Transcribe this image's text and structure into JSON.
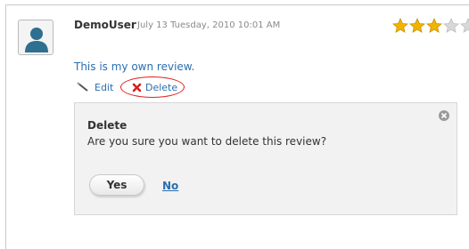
{
  "review": {
    "username": "DemoUser",
    "timestamp": "July 13 Tuesday, 2010 10:01 AM",
    "rating": 3,
    "rating_max": 5,
    "text": "This is my own review.",
    "edit_label": "Edit",
    "delete_label": "Delete"
  },
  "dialog": {
    "title": "Delete",
    "message": "Are you sure you want to delete this review?",
    "yes_label": "Yes",
    "no_label": "No"
  },
  "colors": {
    "link": "#2a6fb0",
    "star_filled": "#f0b400",
    "star_empty": "#d8d8d8",
    "highlight": "#e02020"
  }
}
